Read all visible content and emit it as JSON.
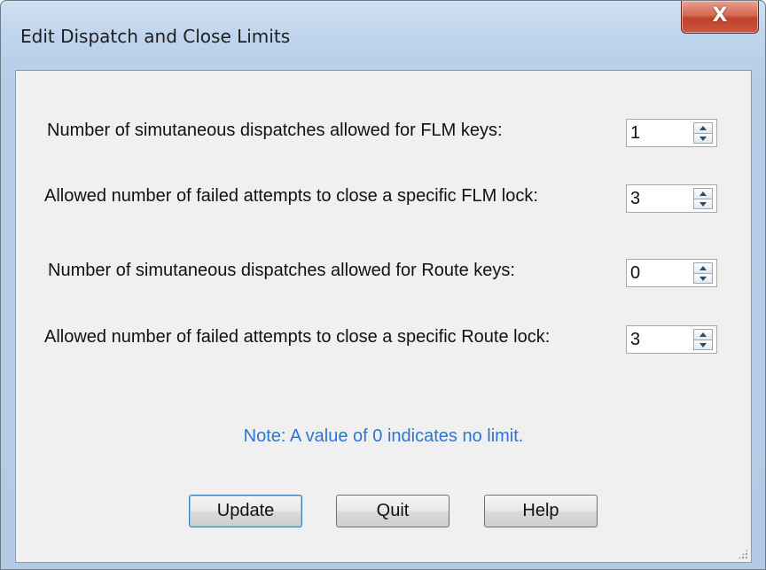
{
  "window": {
    "title": "Edit Dispatch and Close Limits",
    "close_label": "X"
  },
  "fields": [
    {
      "label": "Number of simutaneous dispatches allowed for FLM keys:",
      "value": "1"
    },
    {
      "label": "Allowed number of failed attempts to close a specific FLM lock:",
      "value": "3"
    },
    {
      "label": "Number of simutaneous dispatches allowed for Route keys:",
      "value": "0"
    },
    {
      "label": "Allowed number of failed attempts to close a specific Route lock:",
      "value": "3"
    }
  ],
  "note": "Note: A value of 0 indicates no limit.",
  "buttons": {
    "update": "Update",
    "quit": "Quit",
    "help": "Help"
  },
  "colors": {
    "note": "#2f74d0",
    "close_button": "#c9583f",
    "titlebar": "#bfd4ec"
  },
  "icons": {
    "close": "close-icon",
    "spin_up": "spin-up-arrow-icon",
    "spin_down": "spin-down-arrow-icon",
    "resize": "resize-grip-icon"
  }
}
